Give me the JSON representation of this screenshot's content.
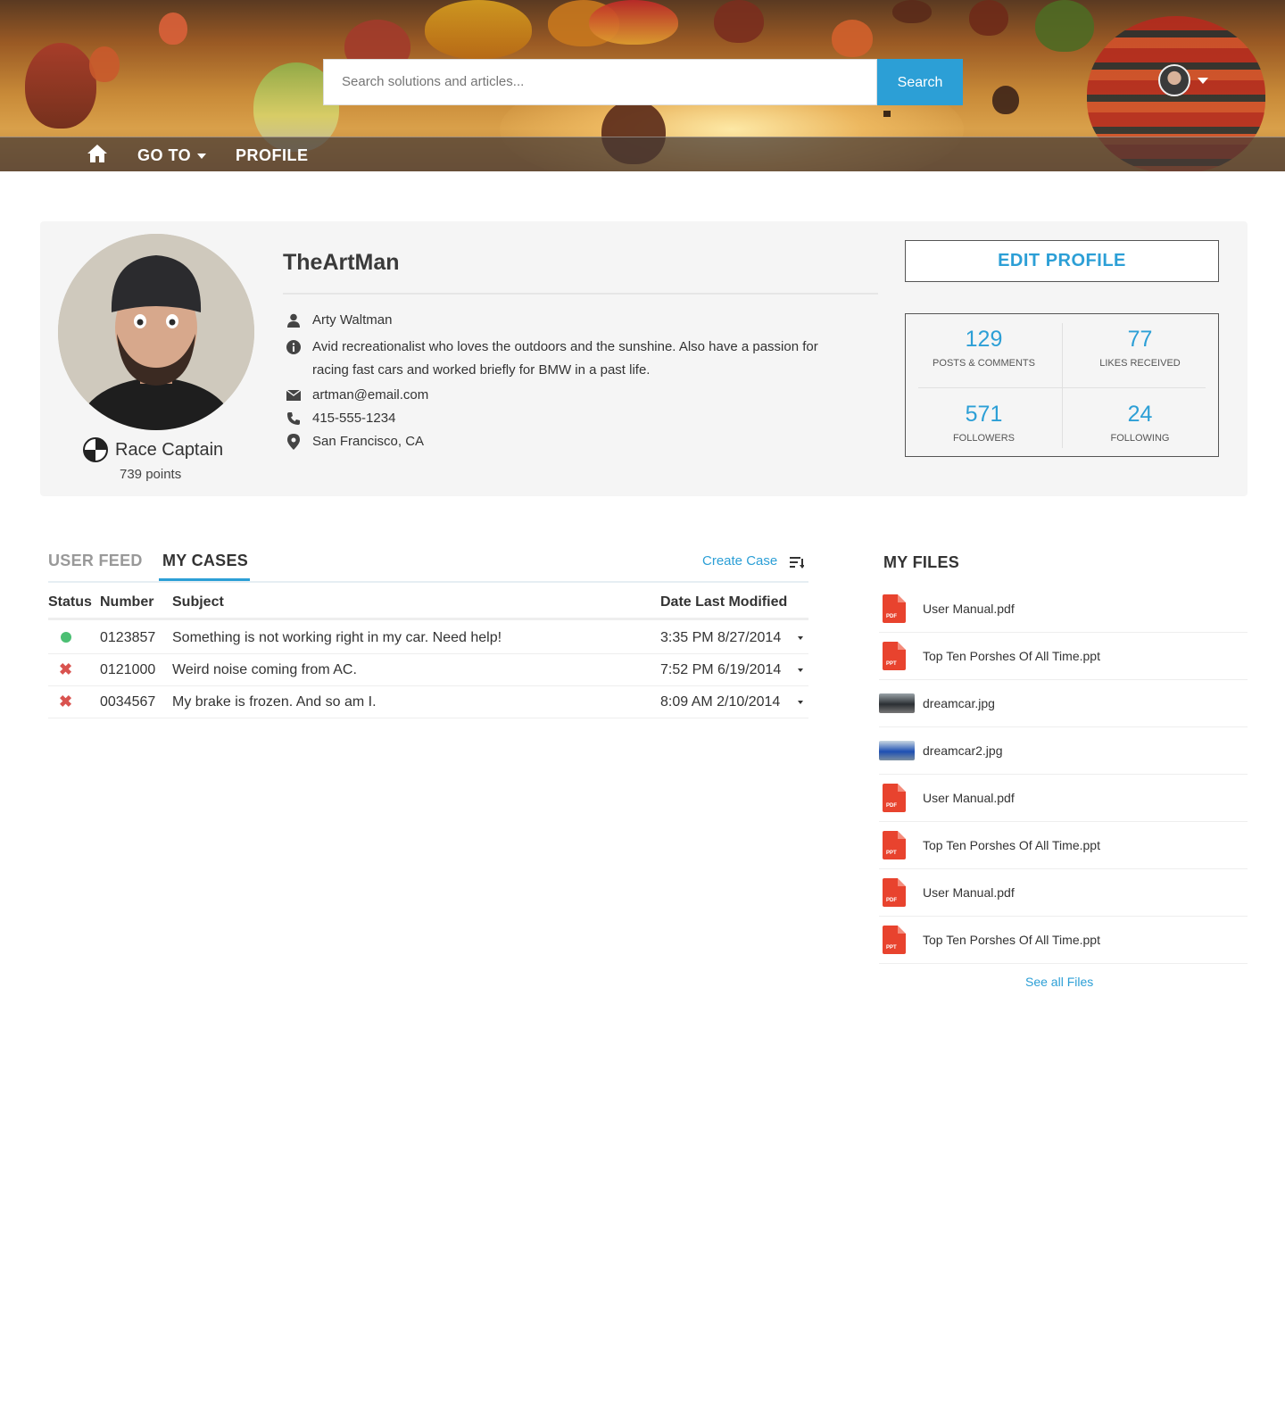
{
  "header": {
    "search_placeholder": "Search solutions and articles...",
    "search_button": "Search",
    "nav": {
      "goto_label": "GO TO",
      "profile_label": "PROFILE"
    }
  },
  "profile": {
    "username": "TheArtMan",
    "full_name": "Arty Waltman",
    "bio": "Avid recreationalist who loves the outdoors and the sunshine. Also have a passion for racing fast cars and worked briefly for BMW in a past life.",
    "email": "artman@email.com",
    "phone": "415-555-1234",
    "location": "San Francisco, CA",
    "rank": "Race Captain",
    "points": "739 points",
    "edit_label": "EDIT PROFILE",
    "stats": [
      {
        "value": "129",
        "label": "POSTS & COMMENTS"
      },
      {
        "value": "77",
        "label": "LIKES RECEIVED"
      },
      {
        "value": "571",
        "label": "FOLLOWERS"
      },
      {
        "value": "24",
        "label": "FOLLOWING"
      }
    ]
  },
  "cases": {
    "tabs": [
      "USER FEED",
      "MY CASES"
    ],
    "active_tab": "MY CASES",
    "create_label": "Create Case",
    "columns": [
      "Status",
      "Number",
      "Subject",
      "Date Last Modified"
    ],
    "rows": [
      {
        "status": "open",
        "number": "0123857",
        "subject": "Something is not working right in my car. Need help!",
        "date": "3:35 PM 8/27/2014"
      },
      {
        "status": "closed",
        "number": "0121000",
        "subject": "Weird noise coming from AC.",
        "date": "7:52 PM 6/19/2014"
      },
      {
        "status": "closed",
        "number": "0034567",
        "subject": "My brake is frozen. And so am I.",
        "date": "8:09 AM 2/10/2014"
      }
    ]
  },
  "files": {
    "title": "MY FILES",
    "items": [
      {
        "name": "User Manual.pdf",
        "type": "PDF"
      },
      {
        "name": "Top Ten Porshes Of All Time.ppt",
        "type": "PPT"
      },
      {
        "name": "dreamcar.jpg",
        "type": "image"
      },
      {
        "name": "dreamcar2.jpg",
        "type": "image"
      },
      {
        "name": "User Manual.pdf",
        "type": "PDF"
      },
      {
        "name": "Top Ten Porshes Of All Time.ppt",
        "type": "PPT"
      },
      {
        "name": "User Manual.pdf",
        "type": "PDF"
      },
      {
        "name": "Top Ten Porshes Of All Time.ppt",
        "type": "PPT"
      }
    ],
    "see_all": "See all Files"
  },
  "colors": {
    "accent": "#2c9fd6",
    "status_open": "#4bbf73",
    "status_closed": "#d9534f",
    "file_red": "#e8432e"
  }
}
